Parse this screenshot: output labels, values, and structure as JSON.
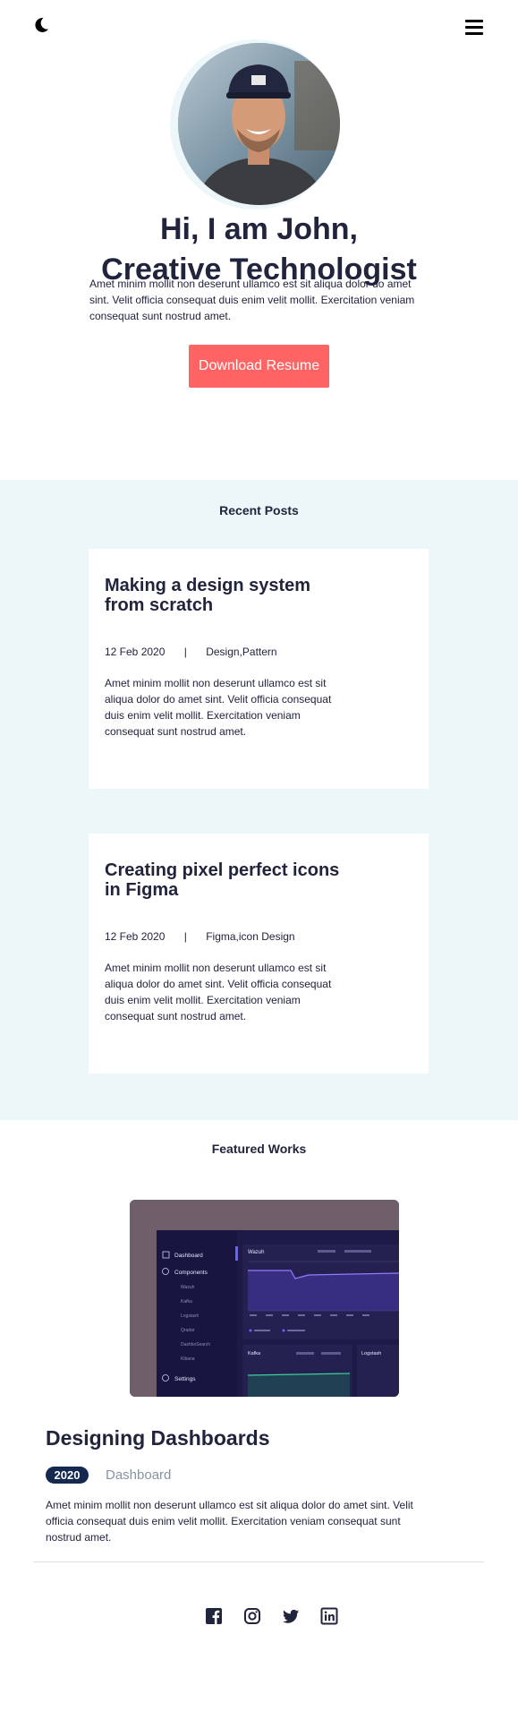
{
  "hero": {
    "title_line1": "Hi, I am John,",
    "title_line2": "Creative Technologist",
    "intro": "Amet minim mollit non deserunt ullamco est sit aliqua dolor do amet sint. Velit officia consequat duis enim velit mollit. Exercitation veniam consequat sunt nostrud amet.",
    "button_label": "Download Resume"
  },
  "recent_posts": {
    "title": "Recent Posts",
    "items": [
      {
        "title": "Making a design system from scratch",
        "date": "12 Feb 2020",
        "separator": "|",
        "tags": "Design,Pattern",
        "excerpt": "Amet minim mollit non deserunt ullamco est sit aliqua dolor do amet sint. Velit officia consequat duis enim velit mollit. Exercitation veniam consequat sunt nostrud amet."
      },
      {
        "title": "Creating pixel perfect icons in Figma",
        "date": "12 Feb 2020",
        "separator": "|",
        "tags": "Figma,icon Design",
        "excerpt": "Amet minim mollit non deserunt ullamco est sit aliqua dolor do amet sint. Velit officia consequat duis enim velit mollit. Exercitation veniam consequat sunt nostrud amet."
      }
    ]
  },
  "featured_works": {
    "title": "Featured Works",
    "work": {
      "title": "Designing Dashboards",
      "year": "2020",
      "category": "Dashboard",
      "description": "Amet minim mollit non deserunt ullamco est sit aliqua dolor do amet sint. Velit officia consequat duis enim velit mollit. Exercitation veniam consequat sunt nostrud amet.",
      "preview": {
        "menu": [
          "Dashboard",
          "Components",
          "Wazuh",
          "Kafka",
          "Logstash",
          "Qradar",
          "DashboSearch",
          "Kibana",
          "Settings"
        ],
        "panel_main": "Wazuh",
        "panel_kafka": "Kafka",
        "panel_logstash": "Logstash"
      }
    }
  },
  "colors": {
    "accent": "#FF6464",
    "dark": "#21243D",
    "section_bg": "#EDF7FA",
    "badge": "#142850",
    "muted": "#8695A4"
  },
  "icons": {
    "theme": "moon-icon",
    "menu": "hamburger-icon",
    "social": [
      "facebook-icon",
      "instagram-icon",
      "twitter-icon",
      "linkedin-icon"
    ]
  }
}
